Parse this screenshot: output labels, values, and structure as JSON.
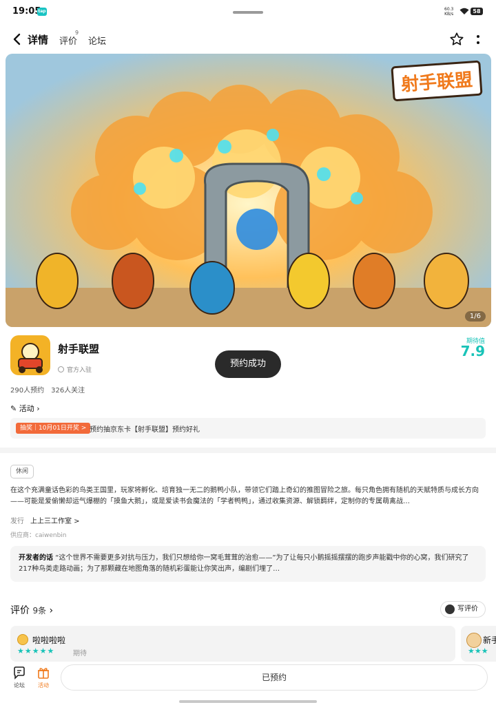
{
  "status_bar": {
    "time": "19:05",
    "net_speed_value": "60.3",
    "net_speed_unit": "KB/s",
    "battery": "58"
  },
  "nav": {
    "tabs": [
      {
        "label": "详情"
      },
      {
        "label": "评价"
      },
      {
        "label": "论坛"
      }
    ],
    "review_superscript": "9"
  },
  "hero": {
    "logo_text": "射手联盟",
    "counter": "1/6"
  },
  "app": {
    "title": "射手联盟",
    "official": "官方入驻",
    "expect_label": "期待值",
    "expect_value": "7.9"
  },
  "toast": "预约成功",
  "stats": {
    "reservations": "290人预约",
    "followers": "326人关注"
  },
  "activity": {
    "heading": "活动",
    "promo_badge": "抽奖｜10月01日开奖 >",
    "promo_text": "预约抽京东卡【射手联盟】预约好礼"
  },
  "details": {
    "tag": "休闲",
    "description": "在这个充满童话色彩的鸟类王国里，玩家将孵化、培育独一无二的鹅鸭小队，带领它们踏上奇幻的推图冒险之旅。每只角色拥有随机的天赋特质与成长方向——可能是爱偷懒却运气爆棚的「摸鱼大鹅」，或是爱读书会魔法的「学者鸭鸭」，通过收集资源、解锁羁绊，定制你的专属萌禽战…",
    "publisher_label": "发行",
    "publisher": "上上三工作室 >",
    "supplier": "供应商：caiwenbin"
  },
  "dev_note": {
    "label": "开发者的话",
    "text": "“这个世界不需要更多对抗与压力，我们只想给你一窝毛茸茸的治愈——”为了让每只小鹅摇摇摆摆的跑步声能戳中你的心窝，我们研究了217种鸟类走路动画；为了那颗藏在地图角落的随机彩蛋能让你笑出声，编剧们埋了…"
  },
  "reviews": {
    "heading": "评价",
    "count": "9条",
    "write_label": "写评价",
    "items": [
      {
        "name": "啦啦啦啦",
        "stars": "★★★★★",
        "tag": "期待"
      },
      {
        "name": "新手",
        "stars": "★★★"
      }
    ]
  },
  "bottom_bar": {
    "forum_label": "论坛",
    "activity_label": "活动",
    "reserved_label": "已预约"
  },
  "colors": {
    "accent": "#19c3b8",
    "promo": "#f26a3a",
    "activity_icon": "#f07a1c"
  }
}
